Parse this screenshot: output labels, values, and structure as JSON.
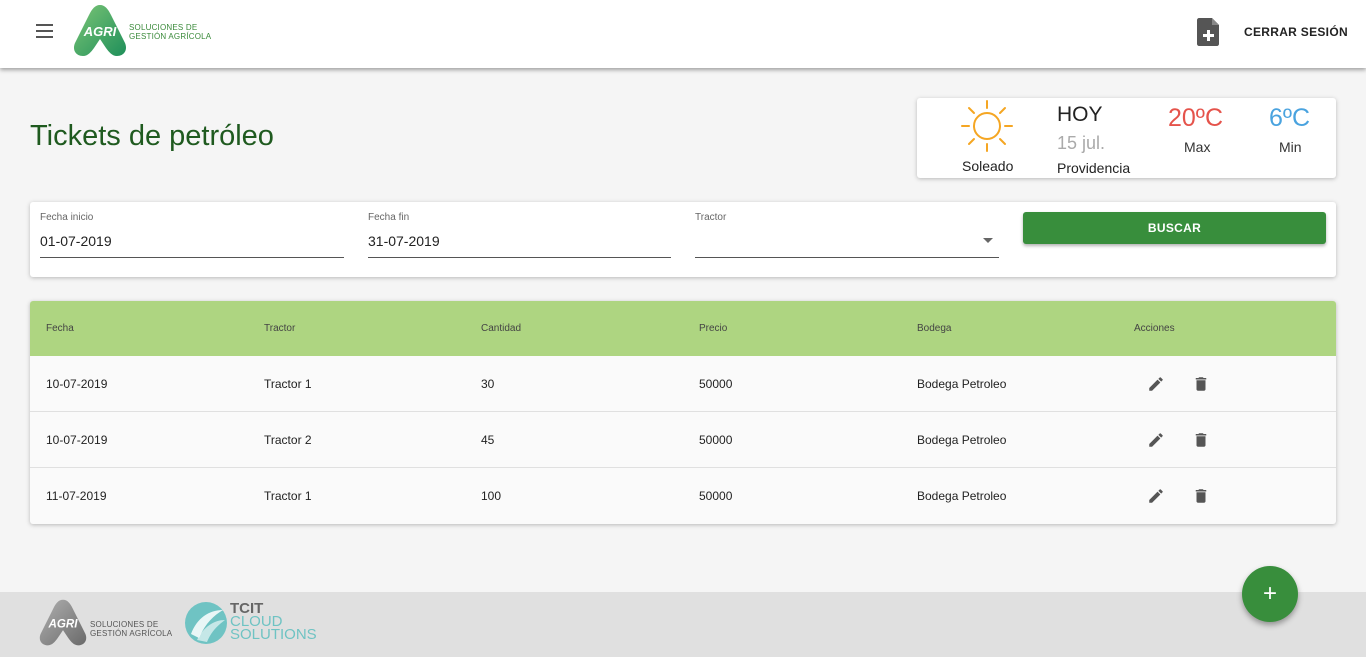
{
  "header": {
    "logo_text_1": "AGRI",
    "logo_text_2": "SOLUCIONES DE",
    "logo_text_3": "GESTIÓN AGRÍCOLA",
    "logout_label": "CERRAR SESIÓN"
  },
  "page": {
    "title": "Tickets de petróleo"
  },
  "weather": {
    "condition": "Soleado",
    "day": "HOY",
    "date": "15 jul.",
    "place": "Providencia",
    "max_value": "20ºC",
    "max_label": "Max",
    "min_value": "6ºC",
    "min_label": "Min"
  },
  "filters": {
    "start_label": "Fecha inicio",
    "start_value": "01-07-2019",
    "end_label": "Fecha fin",
    "end_value": "31-07-2019",
    "tractor_label": "Tractor",
    "tractor_value": "",
    "search_label": "BUSCAR"
  },
  "table": {
    "columns": [
      "Fecha",
      "Tractor",
      "Cantidad",
      "Precio",
      "Bodega",
      "Acciones"
    ],
    "rows": [
      {
        "fecha": "10-07-2019",
        "tractor": "Tractor 1",
        "cantidad": "30",
        "precio": "50000",
        "bodega": "Bodega Petroleo"
      },
      {
        "fecha": "10-07-2019",
        "tractor": "Tractor 2",
        "cantidad": "45",
        "precio": "50000",
        "bodega": "Bodega Petroleo"
      },
      {
        "fecha": "11-07-2019",
        "tractor": "Tractor 1",
        "cantidad": "100",
        "precio": "50000",
        "bodega": "Bodega Petroleo"
      }
    ]
  },
  "footer": {
    "agri_logo_text_1": "AGRI",
    "agri_text_1": "SOLUCIONES DE",
    "agri_text_2": "GESTIÓN AGRÍCOLA",
    "tcit_1": "TCIT",
    "tcit_2": "CLOUD",
    "tcit_3": "SOLUTIONS"
  },
  "fab": {
    "label": "+"
  },
  "icons": {
    "menu": "menu-icon",
    "new_doc": "note-add-icon",
    "edit": "pencil-icon",
    "delete": "trash-icon",
    "sun": "sun-icon",
    "dropdown": "caret-down-icon"
  },
  "colors": {
    "primary": "#388e3c",
    "table_header": "#aed581",
    "title": "#1f5a1f",
    "max_temp": "#e5534b",
    "min_temp": "#4aa3df"
  }
}
